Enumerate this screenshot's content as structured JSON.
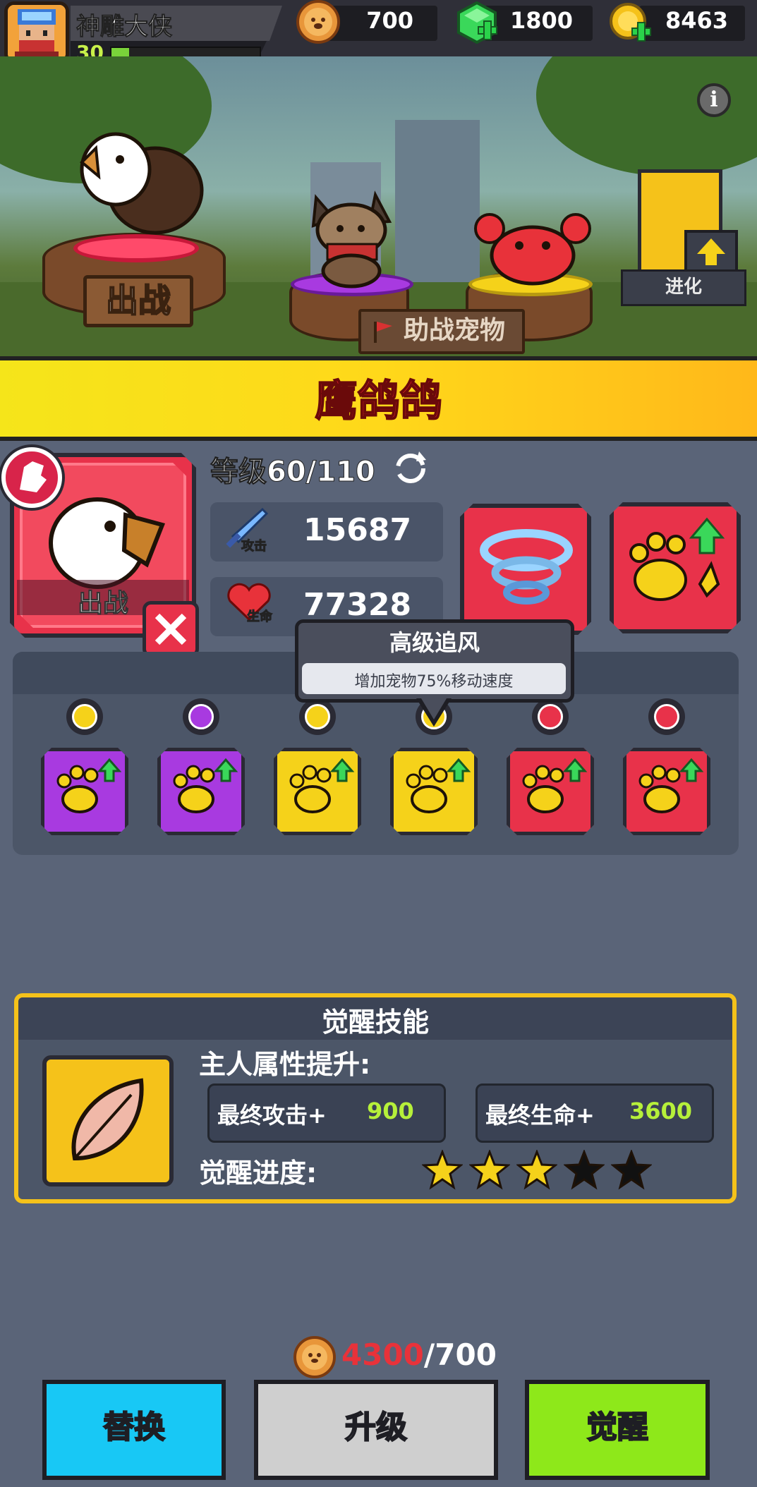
{
  "player": {
    "name": "神雕大侠",
    "level": "30",
    "xp_progress": 0.12
  },
  "currencies": [
    {
      "icon": "paw-coin-icon",
      "value": "700"
    },
    {
      "icon": "gem-icon",
      "value": "1800"
    },
    {
      "icon": "gold-coin-icon",
      "value": "8463"
    }
  ],
  "scene": {
    "battle_sign": "出战",
    "assist_sign": "助战宠物",
    "evolve_label": "进化"
  },
  "pet": {
    "name": "鹰鸽鸽",
    "card_status": "出战",
    "level_text": "等级60/110",
    "attack": {
      "badge": "攻击",
      "value": "15687"
    },
    "hp": {
      "badge": "生命",
      "value": "77328"
    }
  },
  "tooltip": {
    "title": "高级追风",
    "desc": "增加宠物75%移动速度"
  },
  "passives": [
    {
      "rarity": "purple",
      "ring": "#f5d21a"
    },
    {
      "rarity": "purple",
      "ring": "#a83ae0"
    },
    {
      "rarity": "gold",
      "ring": "#f5d21a"
    },
    {
      "rarity": "gold",
      "ring": "#f5d21a"
    },
    {
      "rarity": "red",
      "ring": "#e8324a"
    },
    {
      "rarity": "red",
      "ring": "#e8324a"
    }
  ],
  "awakening": {
    "title": "觉醒技能",
    "subtitle": "主人属性提升:",
    "attack_label": "最终攻击+",
    "attack_value": "900",
    "hp_label": "最终生命+",
    "hp_value": "3600",
    "progress_label": "觉醒进度:",
    "stars_filled": 3,
    "stars_total": 5
  },
  "cost": {
    "have": "4300",
    "sep": "/",
    "need": "700"
  },
  "buttons": {
    "replace": "替换",
    "upgrade": "升级",
    "awaken": "觉醒"
  },
  "colors": {
    "replace": "#18c8f5",
    "upgrade": "#cfcfcf",
    "awaken": "#8ee81a",
    "accent_red": "#e8324a",
    "banner": "#ffd81a"
  }
}
